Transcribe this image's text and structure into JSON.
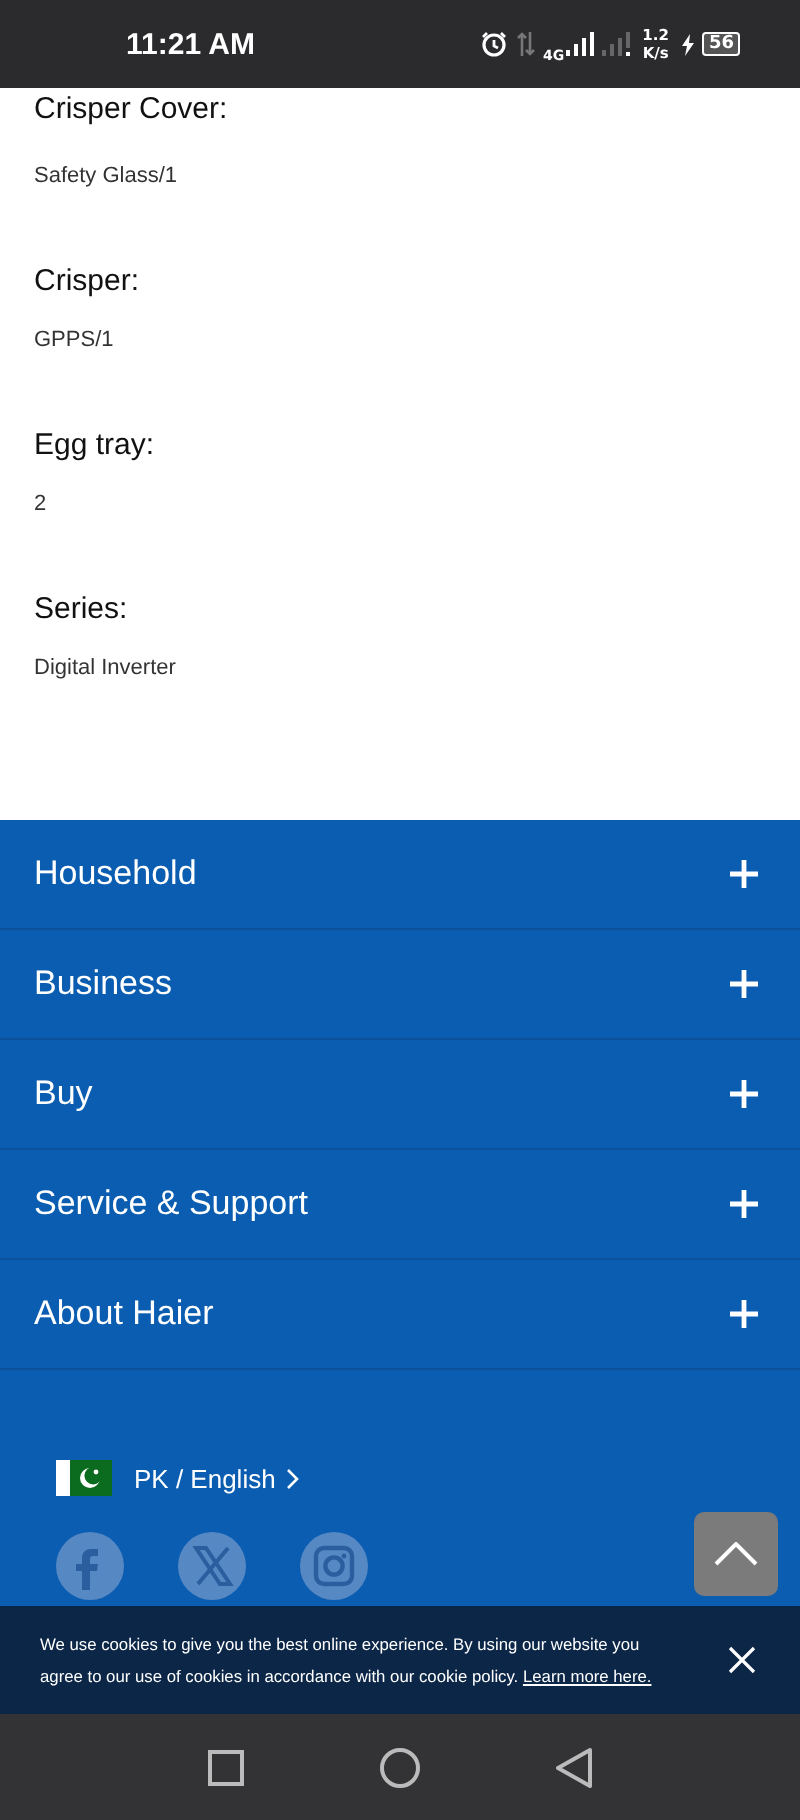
{
  "status_bar": {
    "time": "11:21 AM",
    "network": "4G",
    "speed": "1.2",
    "speed_unit": "K/s",
    "battery": "56"
  },
  "specs": [
    {
      "label": "Crisper Cover:",
      "value": "Safety Glass/1"
    },
    {
      "label": "Crisper:",
      "value": "GPPS/1"
    },
    {
      "label": "Egg tray:",
      "value": "2"
    },
    {
      "label": "Series:",
      "value": "Digital Inverter"
    }
  ],
  "footer_menu": [
    {
      "label": "Household",
      "expanded": false
    },
    {
      "label": "Business",
      "expanded": false
    },
    {
      "label": "Buy",
      "expanded": false
    },
    {
      "label": "Service & Support",
      "expanded": false
    },
    {
      "label": "About Haier",
      "expanded": false
    }
  ],
  "region": {
    "label": "PK / English"
  },
  "social": [
    {
      "kind": "facebook"
    },
    {
      "kind": "x"
    },
    {
      "kind": "instagram"
    }
  ],
  "cookie_banner": {
    "text": "We use cookies to give you the best online experience. By using our website you agree to our use of cookies in accordance with our cookie policy.",
    "link": "Learn more here."
  }
}
